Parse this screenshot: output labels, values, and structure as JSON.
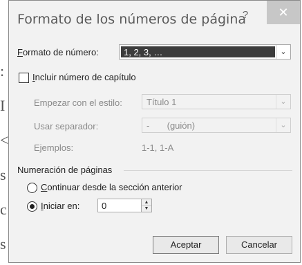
{
  "dialog": {
    "title": "Formato de los números de página",
    "help_label": "?",
    "close_label": "✕"
  },
  "number_format": {
    "label_access": "F",
    "label_rest": "ormato de número:",
    "value": "1, 2, 3, …"
  },
  "include_chapter": {
    "label_access": "I",
    "label_rest": "ncluir número de capítulo",
    "checked": false
  },
  "start_style": {
    "label": "Empezar con el estilo:",
    "value": "Título 1"
  },
  "separator": {
    "label": "Usar separador:",
    "value": "-       (guión)"
  },
  "examples": {
    "label": "Ejemplos:",
    "value": "1-1, 1-A"
  },
  "page_numbering": {
    "heading": "Numeración de páginas",
    "continue_access": "C",
    "continue_rest": "ontinuar desde la sección anterior",
    "start_at_access": "I",
    "start_at_rest": "niciar en:",
    "start_at_value": "0",
    "selected": "start_at"
  },
  "buttons": {
    "ok": "Aceptar",
    "cancel": "Cancelar"
  }
}
